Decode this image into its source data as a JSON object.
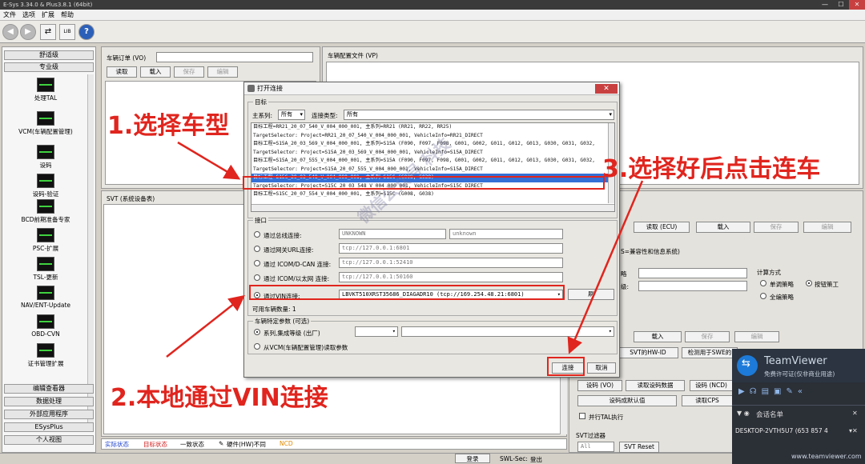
{
  "window": {
    "title": "E-Sys 3.34.0 & Plus3.8.1 (64bit)"
  },
  "menu": [
    "文件",
    "选项",
    "扩展",
    "帮助"
  ],
  "sidebar": {
    "top_items": [
      "舒适级",
      "专业级"
    ],
    "tools": [
      "处理TAL",
      "VCM(车辆配置管理)",
      "设码",
      "设码-验证",
      "BCD前期准备专家",
      "PSC-扩展",
      "TSL-更新",
      "NAV/ENT-Update",
      "OBD-CVN",
      "证书管理扩展"
    ],
    "bottom_items": [
      "编辑查看器",
      "数据处理",
      "外部应用程序",
      "ESysPlus",
      "个人视图"
    ]
  },
  "vo_panel": {
    "label": "车辆订单 (VO)",
    "buttons": [
      "读取",
      "载入",
      "保存",
      "编辑"
    ]
  },
  "vp_panel": {
    "label": "车辆配置文件 (VP)"
  },
  "svt_panel": {
    "label": "SVT (系统设备表)"
  },
  "right_panel": {
    "buttons_row1": [
      "读取 (ECU)",
      "载入",
      "保存",
      "编辑"
    ],
    "compat_label": "S=兼容性和信息系统)",
    "dd_label_1": "略",
    "dd_label_2": "级:",
    "calc_title": "计算方式",
    "calc_options": [
      "单调策略",
      "按钮策工",
      "全编策略"
    ],
    "buttons_row2": [
      "载入",
      "保存",
      "编辑"
    ],
    "svt_btn": "SVT的HW-ID",
    "check_btn": "检测用于SWE的",
    "code_buttons": [
      "设码 (VO)",
      "读取设码数据",
      "设码 (NCD)"
    ],
    "code_default_btn": "设码成默认值",
    "read_cps_btn": "读取CPS",
    "parallel_label": "并行TAL执行",
    "svt_filter_label": "SVT过滤器",
    "svt_filter_value": "All",
    "svt_reset_btn": "SVT Reset"
  },
  "dialog": {
    "title": "打开连接",
    "target_group": "目标",
    "main_series_label": "主系列:",
    "main_series_value": "所有",
    "conn_type_label": "连接类型:",
    "conn_type_value": "所有",
    "rows": [
      "目标工程=RR21_20_07_540_V_004_000_001, 主系列=RR21    (RR21, RR22, RR25)",
      "TargetSelector: Project=RR21_20_07_540_V_004_000_001, VehicleInfo=RR21_DIRECT",
      "目标工程=S15A_20_03_569_V_004_000_001, 主系列=S15A    (F090, F097, F098, G001, G002, G011, G012, G013, G030, G031, G032,",
      "TargetSelector: Project=S15A_20_03_569_V_004_000_001, VehicleInfo=S15A_DIRECT",
      "目标工程=S15A_20_07_555_V_004_000_001, 主系列=S15A    (F090, F097, F098, G001, G002, G011, G012, G013, G030, G031, G032,",
      "TargetSelector: Project=S15A_20_07_555_V_004_000_001, VehicleInfo=S15A_DIRECT",
      "目标工程=S15C_20_03_548_V_004_000_001, 主系列=S15C    (G008, G038)",
      "TargetSelector: Project=S15C_20_03_548_V_004_000_001, VehicleInfo=S15C_DIRECT",
      "目标工程=S15C_20_07_554_V_004_000_001, 主系列=S15C    (G008, G038)"
    ],
    "selected_row": 6,
    "interface_group": "接口",
    "connections": [
      {
        "label": "通过总线连接:",
        "value": "UNKNOWN",
        "value2": "unknown"
      },
      {
        "label": "通过网关URL连接:",
        "value": "tcp://127.0.0.1:6801"
      },
      {
        "label": "通过 ICOM/D-CAN 连接:",
        "value": "tcp://127.0.0.1:52410"
      },
      {
        "label": "通过 ICOM/以太网 连接:",
        "value": "tcp://127.0.0.1:50160"
      },
      {
        "label": "通过VIN连接:",
        "value": "LBVKT510XRST35686_DIAGADR10  (tcp://169.254.48.21:6801)"
      }
    ],
    "refresh_btn": "刷",
    "available_vehicles": "可用车辆数量: 1",
    "vehicle_params_group": "车辆特定参数 (可选)",
    "param_option_1": "系列,集成等级 (出厂)",
    "param_option_2": "从VCM(车辆配置管理)读取参数",
    "connect_btn": "连接",
    "cancel_btn": "取消"
  },
  "annotations": {
    "step1": "1.选择车型",
    "step2": "2.本地通过VIN连接",
    "step3": "3.选择好后点击连车",
    "color": "#e0251e"
  },
  "status_bar": {
    "actual": "实际状态",
    "target": "目标状态",
    "consistent": "一致状态",
    "hw_diff": "硬件(HW)不同",
    "ncd": "NCD"
  },
  "bottom_bar": {
    "login_btn": "登录",
    "swl_sec": "SWL-Sec:",
    "logout": "登出"
  },
  "teamviewer": {
    "brand": "TeamViewer",
    "license": "免费许可证(仅非商业用途)",
    "session_list": "会话名单",
    "device": "DESKTOP-2VTH5U7 (653 857 4",
    "url": "www.teamviewer.com"
  },
  "watermark": "微信公众号 科技"
}
